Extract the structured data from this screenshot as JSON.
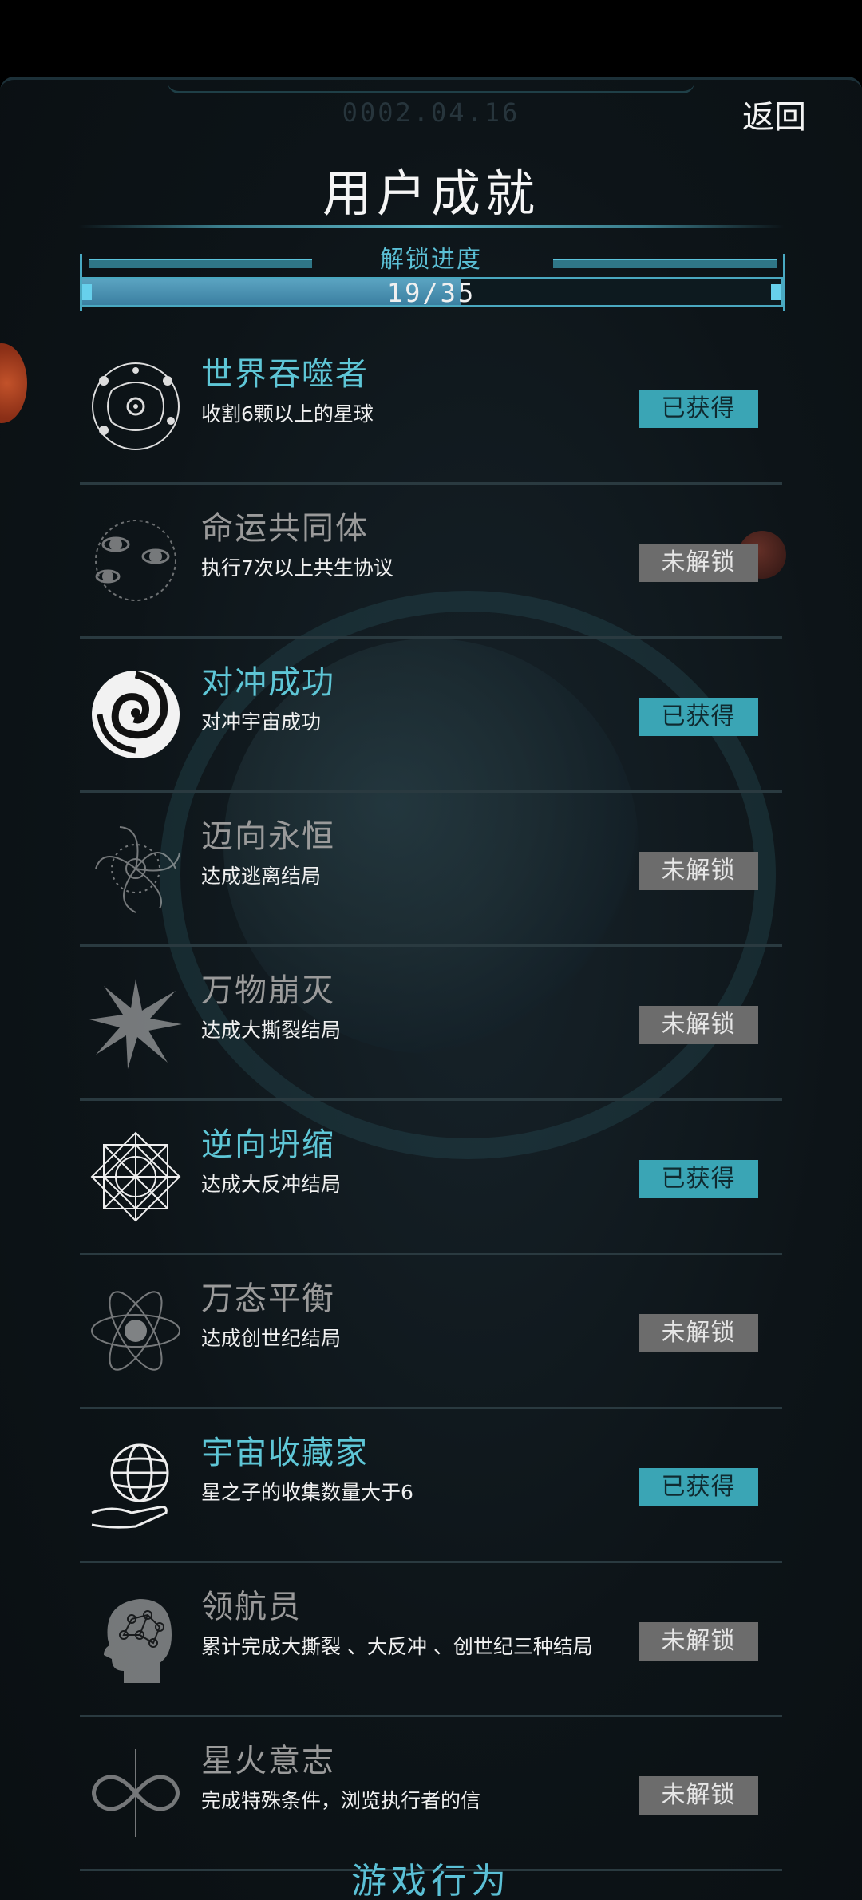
{
  "header": {
    "date": "0002.04.16",
    "back_label": "返回",
    "title": "用户成就"
  },
  "progress": {
    "label": "解锁进度",
    "text": "19/35",
    "unlocked": 19,
    "total": 35
  },
  "colors": {
    "accent": "#5ec6d6",
    "earned_button": "#3aa5b5",
    "locked_button": "#6c6c6c"
  },
  "achievements": [
    {
      "name": "世界吞噬者",
      "desc": "收割6颗以上的星球",
      "status": "已获得",
      "icon": "orbit-system-icon"
    },
    {
      "name": "命运共同体",
      "desc": "执行7次以上共生协议",
      "status": "未解锁",
      "icon": "linked-planets-icon"
    },
    {
      "name": "对冲成功",
      "desc": "对冲宇宙成功",
      "status": "已获得",
      "icon": "swirl-icon"
    },
    {
      "name": "迈向永恒",
      "desc": "达成逃离结局",
      "status": "未解锁",
      "icon": "vortex-icon"
    },
    {
      "name": "万物崩灭",
      "desc": "达成大撕裂结局",
      "status": "未解锁",
      "icon": "burst-icon"
    },
    {
      "name": "逆向坍缩",
      "desc": "达成大反冲结局",
      "status": "已获得",
      "icon": "mandala-icon"
    },
    {
      "name": "万态平衡",
      "desc": "达成创世纪结局",
      "status": "未解锁",
      "icon": "atom-icon"
    },
    {
      "name": "宇宙收藏家",
      "desc": "星之子的收集数量大于6",
      "status": "已获得",
      "icon": "globe-hand-icon"
    },
    {
      "name": "领航员",
      "desc": "累计完成大撕裂 、大反冲 、创世纪三种结局",
      "status": "未解锁",
      "icon": "brain-head-icon"
    },
    {
      "name": "星火意志",
      "desc": "完成特殊条件，浏览执行者的信",
      "status": "未解锁",
      "icon": "infinity-icon"
    }
  ],
  "footer": {
    "partial_text": "游戏行为"
  }
}
